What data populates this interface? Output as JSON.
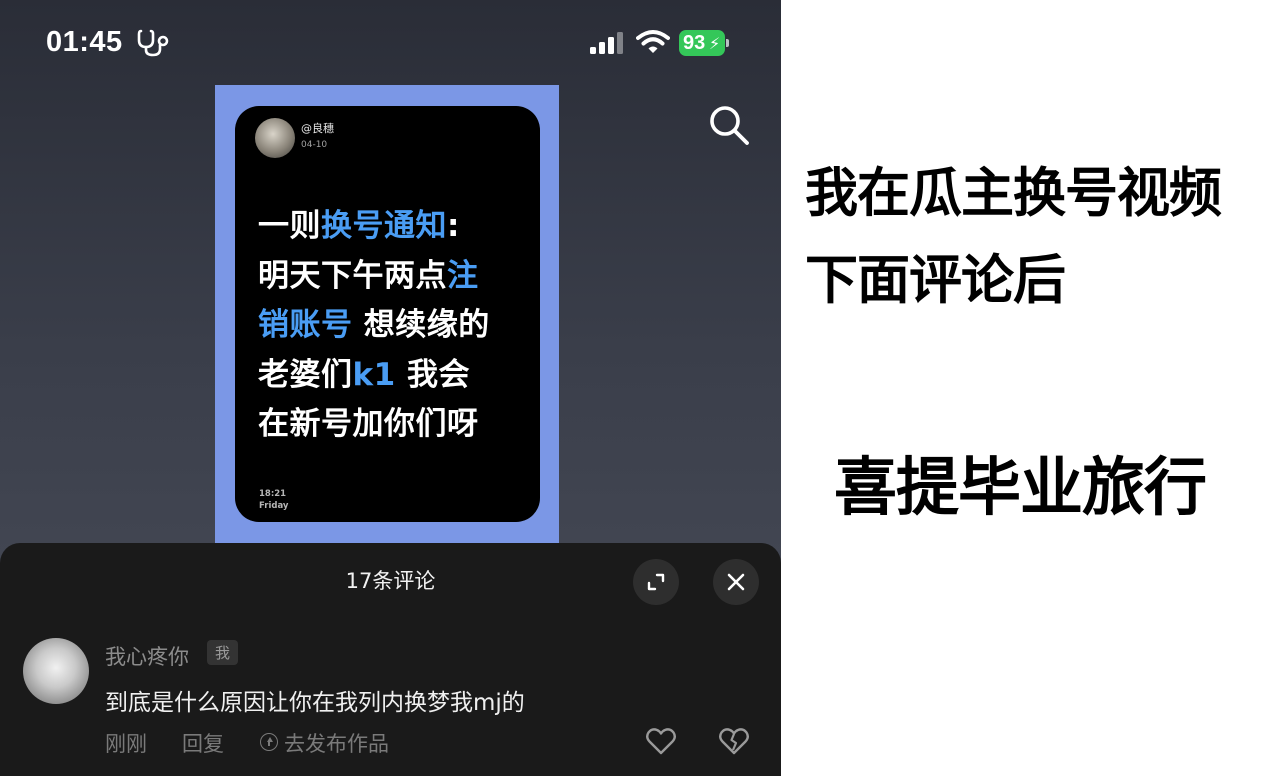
{
  "status_bar": {
    "time": "01:45",
    "battery": "93"
  },
  "post": {
    "handle": "@良穗",
    "date": "04-10",
    "text_segments": [
      {
        "text": "一则",
        "highlight": false
      },
      {
        "text": "换号通知",
        "highlight": true
      },
      {
        "text": ":\n明天下午两点",
        "highlight": false
      },
      {
        "text": "注\n销账号",
        "highlight": true
      },
      {
        "text": " 想续缘的\n老婆们",
        "highlight": false
      },
      {
        "text": "k1",
        "highlight": true
      },
      {
        "text": " 我会\n在新号加你们呀",
        "highlight": false
      }
    ],
    "time": "18:21",
    "day": "Friday"
  },
  "comments": {
    "title": "17条评论",
    "items": [
      {
        "user": "我心疼你",
        "badge": "我",
        "text": "到底是什么原因让你在我列内换梦我mj的",
        "time": "刚刚",
        "reply": "回复",
        "share": "去发布作品"
      }
    ]
  },
  "caption": {
    "line1": "我在瓜主换号视频",
    "line2": "下面评论后",
    "line3": "喜提毕业旅行"
  },
  "colors": {
    "highlight": "#4a9df4",
    "battery": "#34c759",
    "post_border": "#7b97e6"
  }
}
